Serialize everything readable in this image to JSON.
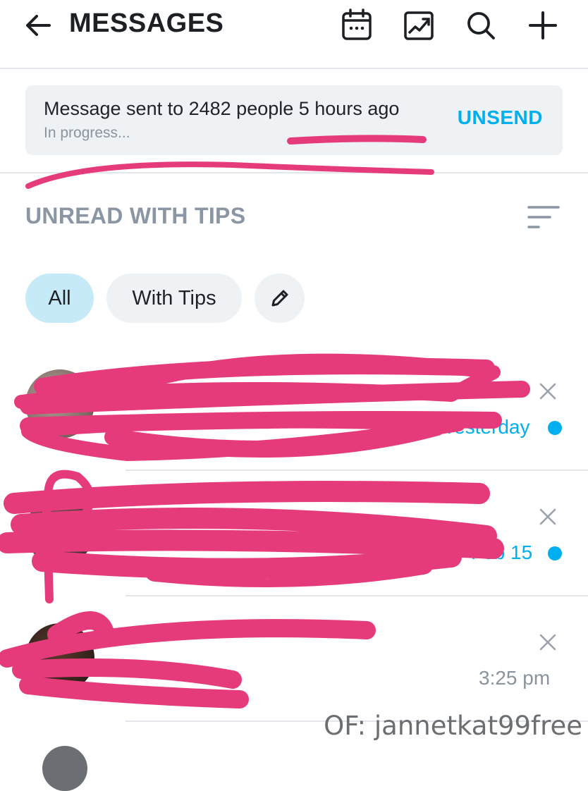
{
  "header": {
    "title": "MESSAGES",
    "icons": [
      "back-arrow-icon",
      "calendar-icon",
      "image-chart-icon",
      "search-icon",
      "plus-icon"
    ]
  },
  "banner": {
    "text": "Message sent to 2482 people 5 hours ago",
    "status": "In progress...",
    "action_label": "UNSEND"
  },
  "section": {
    "title": "UNREAD WITH TIPS",
    "sort_icon": "sort-lines-icon"
  },
  "filters": {
    "chips": [
      {
        "label": "All",
        "selected": true
      },
      {
        "label": "With Tips",
        "selected": false
      }
    ],
    "edit_icon": "pencil-icon"
  },
  "chats": [
    {
      "name_fragment": "...",
      "time": "Yesterday",
      "time_color": "#00aff0",
      "unread": true
    },
    {
      "name_fragment": "",
      "time": "Feb 15",
      "time_color": "#00aff0",
      "unread": true
    },
    {
      "name_fragment": "",
      "time": "3:25 pm",
      "time_color": "#8a949e",
      "unread": false
    }
  ],
  "watermark": "OF: jannetkat99free",
  "colors": {
    "accent": "#00aff0",
    "scribble": "#e63b7a",
    "chip_selected": "#c6eaf8"
  }
}
